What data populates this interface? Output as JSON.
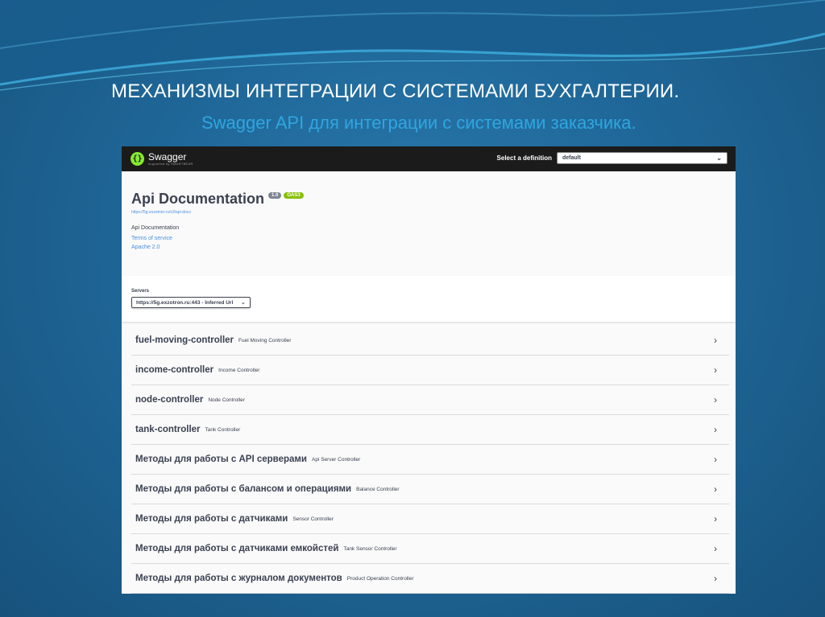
{
  "slide": {
    "title": "МЕХАНИЗМЫ ИНТЕГРАЦИИ С СИСТЕМАМИ БУХГАЛТЕРИИ.",
    "subtitle": "Swagger API для интеграции с системами заказчика."
  },
  "swagger": {
    "logo_name": "Swagger",
    "logo_sub": "supported by SMARTBEAR",
    "select_definition_label": "Select a definition",
    "definition_value": "default",
    "info": {
      "title": "Api Documentation",
      "version": "1.0",
      "oas": "OAS3",
      "url": "https://5g.exzotron.ru/v3/api-docs",
      "description": "Api Documentation",
      "terms_link": "Terms of service",
      "license_link": "Apache 2.0"
    },
    "servers": {
      "label": "Servers",
      "value": "https://5g.exzotron.ru:443 - Inferred Url"
    },
    "tags": [
      {
        "name": "fuel-moving-controller",
        "desc": "Fuel Moving Controller"
      },
      {
        "name": "income-controller",
        "desc": "Income Controller"
      },
      {
        "name": "node-controller",
        "desc": "Node Controller"
      },
      {
        "name": "tank-controller",
        "desc": "Tank Controller"
      },
      {
        "name": "Методы для работы с API серверами",
        "desc": "Api Server Controller"
      },
      {
        "name": "Методы для работы с балансом и операциями",
        "desc": "Balance Controller"
      },
      {
        "name": "Методы для работы с датчиками",
        "desc": "Sensor Controller"
      },
      {
        "name": "Методы для работы с датчиками емкойстей",
        "desc": "Tank Sensor Controller"
      },
      {
        "name": "Методы для работы с журналом документов",
        "desc": "Product Operation Controller"
      }
    ]
  }
}
